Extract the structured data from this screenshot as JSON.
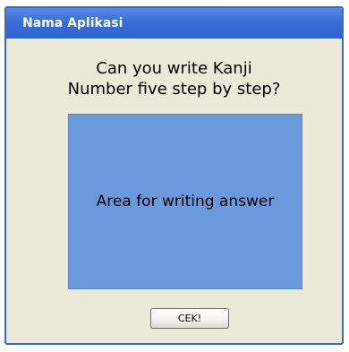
{
  "window": {
    "title": "Nama Aplikasi"
  },
  "main": {
    "question_line1": "Can you write Kanji",
    "question_line2": "Number five step by step?",
    "answer_area_label": "Area for writing answer",
    "submit_label": "CEK!"
  },
  "colors": {
    "titlebar": "#3a6fd8",
    "window_background": "#ece9d8",
    "answer_area": "#6b9adc"
  }
}
